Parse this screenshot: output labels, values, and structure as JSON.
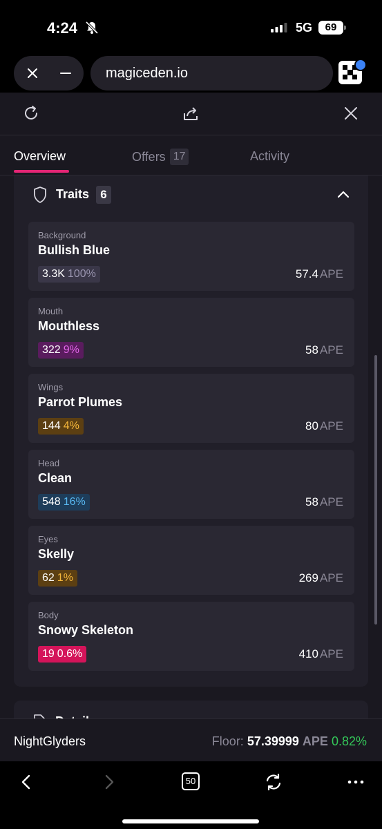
{
  "status_bar": {
    "time": "4:24",
    "network": "5G",
    "battery": "69"
  },
  "browser": {
    "url": "magiceden.io"
  },
  "tabs": [
    {
      "label": "Overview",
      "active": true
    },
    {
      "label": "Offers",
      "count": "17",
      "active": false
    },
    {
      "label": "Activity",
      "active": false
    }
  ],
  "traits": {
    "title": "Traits",
    "count": "6",
    "items": [
      {
        "type": "Background",
        "value": "Bullish Blue",
        "count": "3.3K",
        "percent": "100%",
        "price": "57.4",
        "unit": "APE",
        "color": "#9a95b0",
        "bg": "#3a3748"
      },
      {
        "type": "Mouth",
        "value": "Mouthless",
        "count": "322",
        "percent": "9%",
        "price": "58",
        "unit": "APE",
        "color": "#e266e8",
        "bg": "#5a1c5e"
      },
      {
        "type": "Wings",
        "value": "Parrot Plumes",
        "count": "144",
        "percent": "4%",
        "price": "80",
        "unit": "APE",
        "color": "#f5b73b",
        "bg": "#5c3f12"
      },
      {
        "type": "Head",
        "value": "Clean",
        "count": "548",
        "percent": "16%",
        "price": "58",
        "unit": "APE",
        "color": "#58b7f0",
        "bg": "#1e3d5a"
      },
      {
        "type": "Eyes",
        "value": "Skelly",
        "count": "62",
        "percent": "1%",
        "price": "269",
        "unit": "APE",
        "color": "#f5b73b",
        "bg": "#5c3f12"
      },
      {
        "type": "Body",
        "value": "Snowy Skeleton",
        "count": "19",
        "percent": "0.6%",
        "price": "410",
        "unit": "APE",
        "color": "#ffffff",
        "bg": "#d4145a"
      }
    ]
  },
  "details": {
    "title": "Details"
  },
  "floor_bar": {
    "collection": "NightGlyders",
    "floor_label": "Floor:",
    "floor_value": "57.39999",
    "floor_unit": "APE",
    "change": "0.82%"
  },
  "nav": {
    "tabs_count": "50"
  },
  "colors": {
    "accent": "#e42575",
    "positive": "#34c759"
  }
}
